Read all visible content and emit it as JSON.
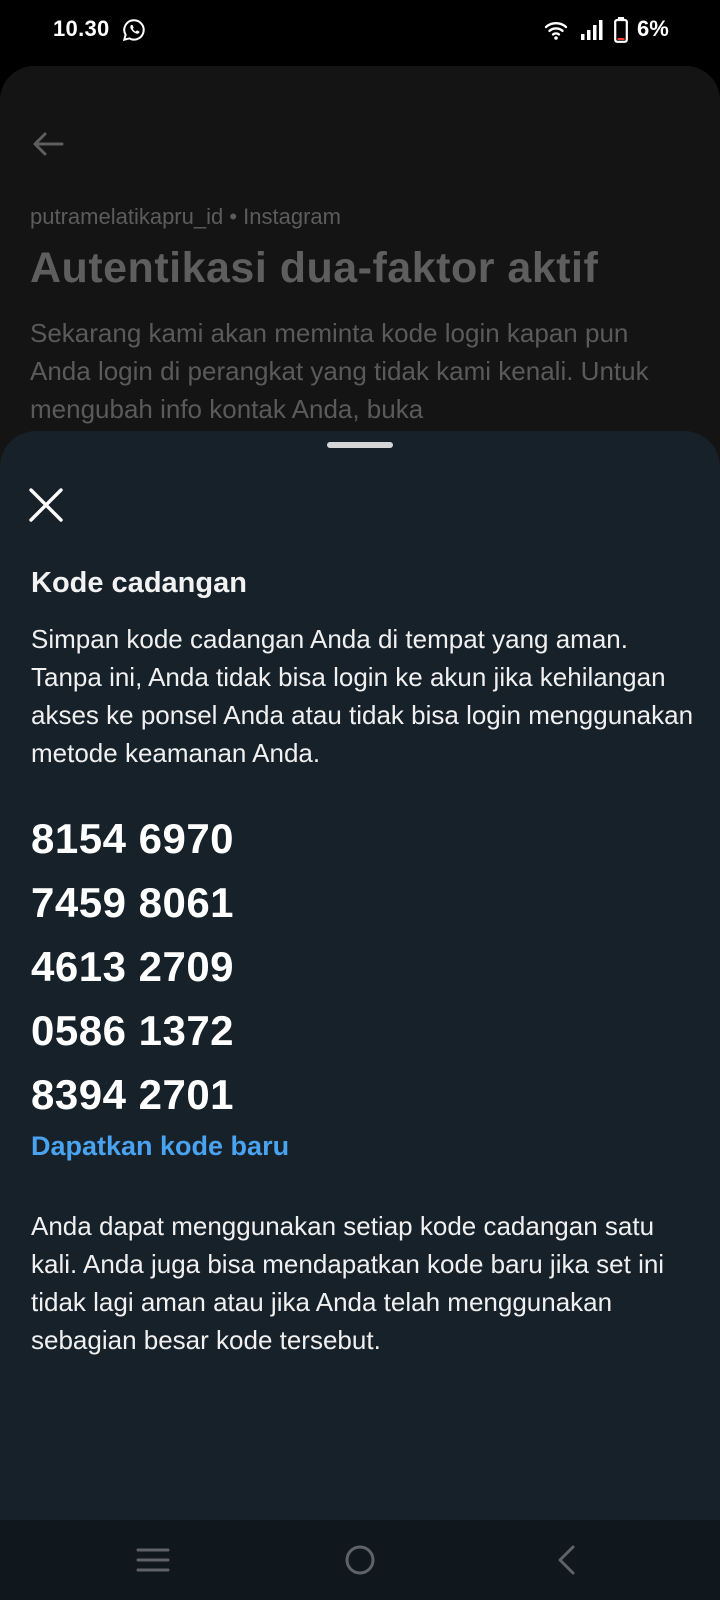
{
  "status_bar": {
    "time": "10.30",
    "battery": "6%",
    "icons": [
      "whatsapp-icon",
      "wifi-icon",
      "signal-icon",
      "battery-icon"
    ]
  },
  "background_page": {
    "account": "putramelatikapru_id • Instagram",
    "title": "Autentikasi dua-faktor aktif",
    "description": "Sekarang kami akan meminta kode login kapan pun Anda login di perangkat yang tidak kami kenali. Untuk mengubah info kontak Anda, buka"
  },
  "sheet": {
    "title": "Kode cadangan",
    "description": "Simpan kode cadangan Anda di tempat yang aman. Tanpa ini, Anda tidak bisa login ke akun jika kehilangan akses ke ponsel Anda atau tidak bisa login menggunakan metode keamanan Anda.",
    "codes": [
      "8154 6970",
      "7459 8061",
      "4613 2709",
      "0586 1372",
      "8394 2701"
    ],
    "new_code_link": "Dapatkan kode baru",
    "footer": "Anda dapat menggunakan setiap kode cadangan satu kali. Anda juga bisa mendapatkan kode baru jika set ini tidak lagi aman atau jika Anda telah menggunakan sebagian besar kode tersebut."
  },
  "colors": {
    "sheet_background": "#17212a",
    "link": "#4aa3f0",
    "text": "#f0f0f0"
  }
}
